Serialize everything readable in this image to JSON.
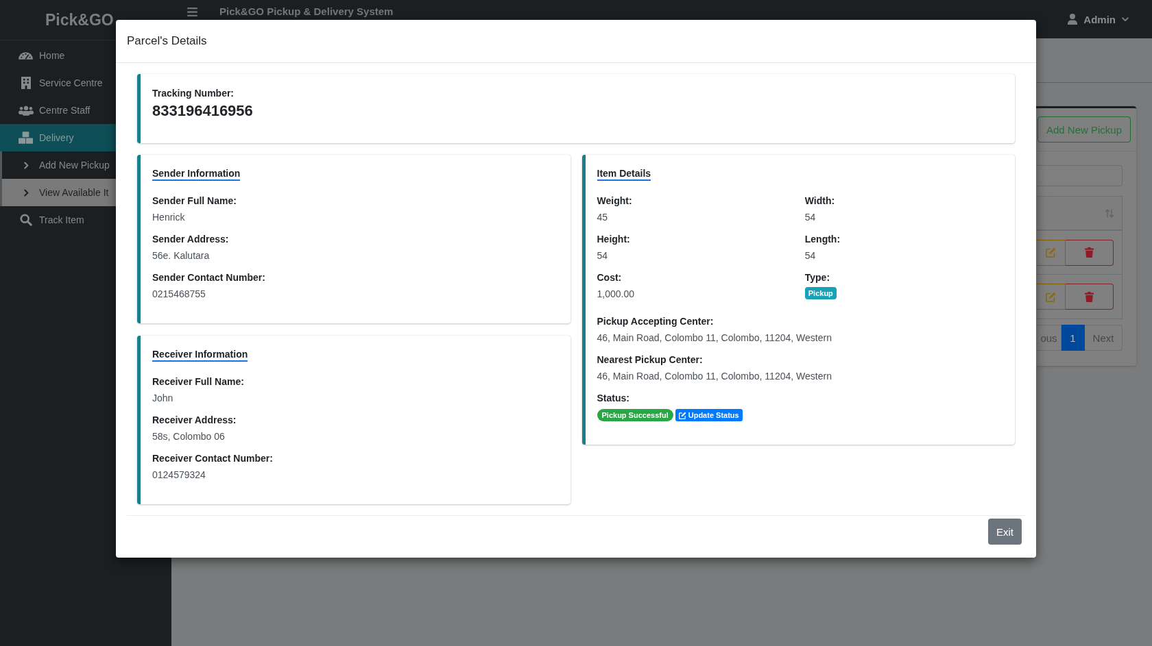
{
  "sidebar": {
    "brand": "Pick&GO",
    "items": [
      {
        "label": "Home",
        "selected": false
      },
      {
        "label": "Service Centre",
        "selected": false
      },
      {
        "label": "Centre Staff",
        "selected": false
      },
      {
        "label": "Delivery",
        "selected": true,
        "expanded": true,
        "children": [
          {
            "label": "Add New Pickup",
            "selected": false
          },
          {
            "label": "View Available It",
            "selected": true
          }
        ]
      },
      {
        "label": "Track Item",
        "selected": false
      }
    ]
  },
  "topbar": {
    "title": "Pick&GO Pickup & Delivery System",
    "user": "Admin"
  },
  "items_card": {
    "add_button": "Add New Pickup",
    "pagination": {
      "previous": "ous",
      "pages": [
        {
          "label": "1",
          "selected": true
        }
      ],
      "next": "Next"
    }
  },
  "modal": {
    "title": "Parcel's Details",
    "tracking": {
      "label": "Tracking Number:",
      "value": "833196416956"
    },
    "sender": {
      "heading": "Sender Information",
      "fields": [
        {
          "label": "Sender Full Name:",
          "value": "Henrick"
        },
        {
          "label": "Sender Address:",
          "value": "56e. Kalutara"
        },
        {
          "label": "Sender Contact Number:",
          "value": "0215468755"
        }
      ]
    },
    "receiver": {
      "heading": "Receiver Information",
      "fields": [
        {
          "label": "Receiver Full Name:",
          "value": "John"
        },
        {
          "label": "Receiver Address:",
          "value": "58s, Colombo 06"
        },
        {
          "label": "Receiver Contact Number:",
          "value": "0124579324"
        }
      ]
    },
    "item_details": {
      "heading": "Item Details",
      "measures": [
        {
          "label": "Weight:",
          "value": "45",
          "kind": "text"
        },
        {
          "label": "Width:",
          "value": "54",
          "kind": "text"
        },
        {
          "label": "Height:",
          "value": "54",
          "kind": "text"
        },
        {
          "label": "Length:",
          "value": "54",
          "kind": "text"
        },
        {
          "label": "Cost:",
          "value": "1,000.00",
          "kind": "text"
        },
        {
          "label": "Type:",
          "value": "Pickup",
          "kind": "badge"
        }
      ],
      "centers": [
        {
          "label": "Pickup Accepting Center:",
          "value": "46, Main Road, Colombo 11, Colombo, 11204, Western"
        },
        {
          "label": "Nearest Pickup Center:",
          "value": "46, Main Road, Colombo 11, Colombo, 11204, Western"
        }
      ],
      "status": {
        "label": "Status:",
        "value": "Pickup Successful",
        "action": "Update Status"
      }
    },
    "exit_button": "Exit"
  }
}
